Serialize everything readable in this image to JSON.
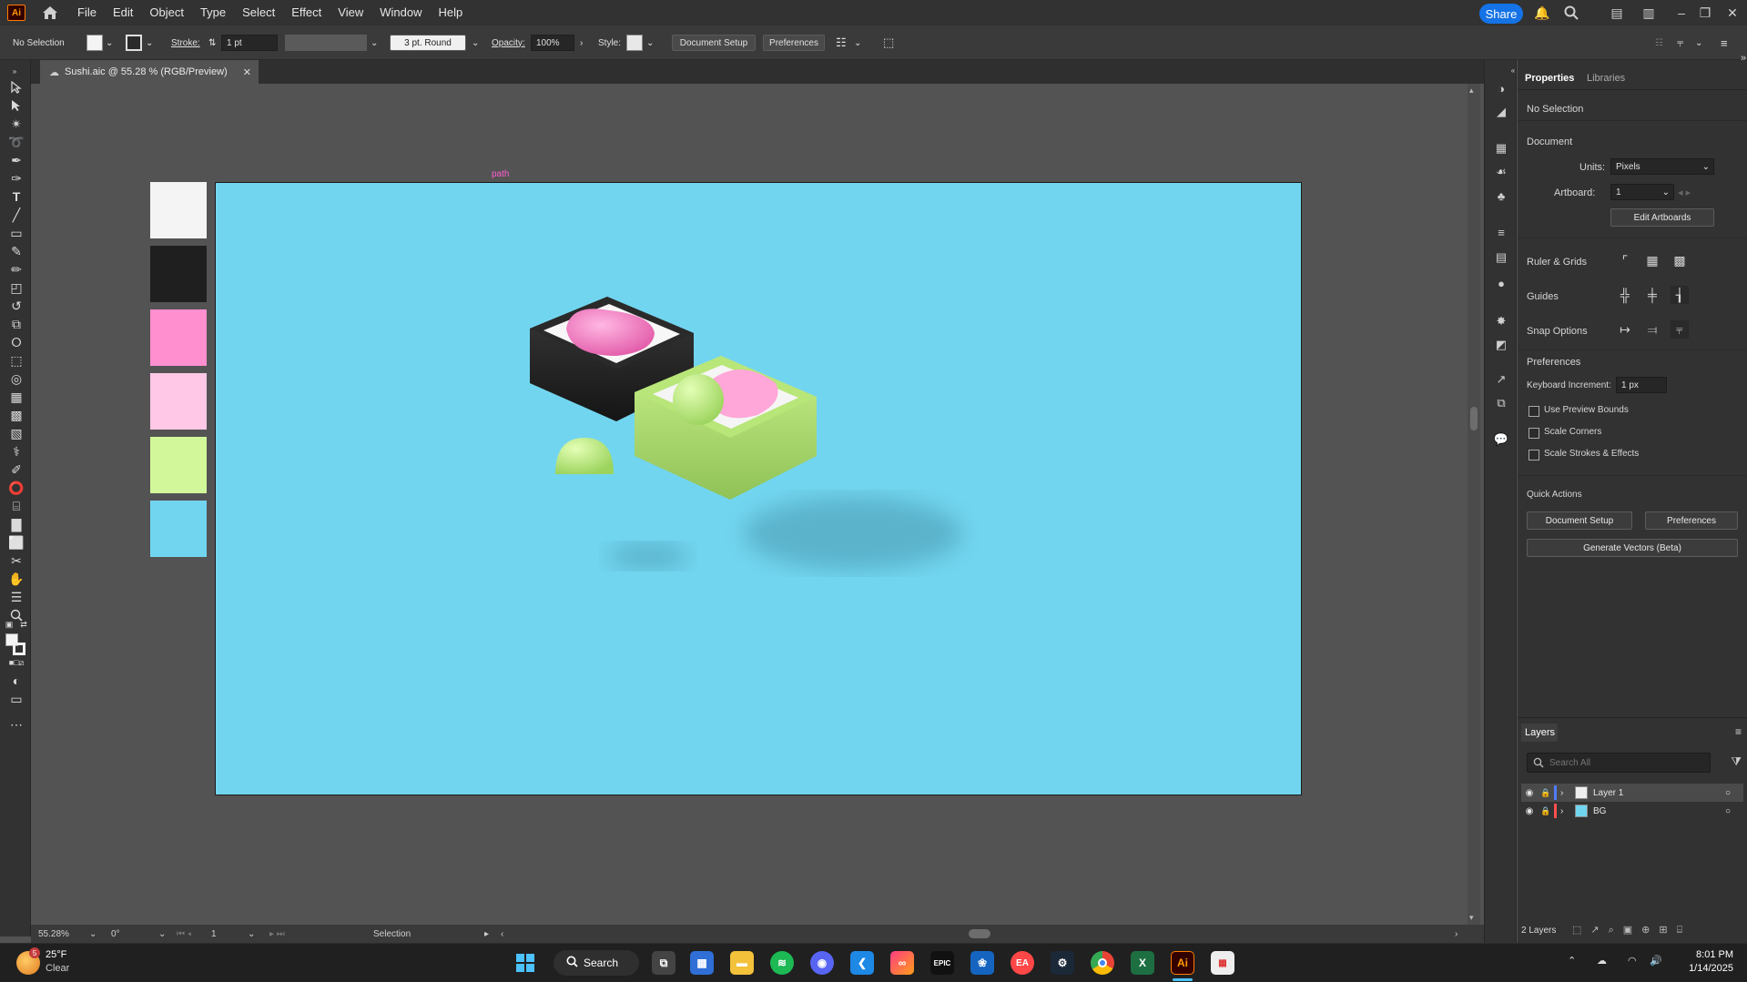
{
  "menubar": {
    "logo": "Ai",
    "items": [
      "File",
      "Edit",
      "Object",
      "Type",
      "Select",
      "Effect",
      "View",
      "Window",
      "Help"
    ],
    "share_label": "Share"
  },
  "control_bar": {
    "selection": "No Selection",
    "stroke_label": "Stroke:",
    "stroke_value": "1 pt",
    "brush_value": "3 pt. Round",
    "opacity_label": "Opacity:",
    "opacity_value": "100%",
    "style_label": "Style:",
    "document_setup": "Document Setup",
    "preferences": "Preferences"
  },
  "document_tab": {
    "title": "Sushi.aic @ 55.28 % (RGB/Preview)"
  },
  "canvas": {
    "path_label": "path",
    "swatches": [
      "#f4f4f4",
      "#1f1f1f",
      "#ff8fcf",
      "#ffc8e6",
      "#d2f79a",
      "#72d5ef"
    ],
    "artboard_color": "#72d5ef"
  },
  "status_bar": {
    "zoom": "55.28%",
    "rotation": "0°",
    "artboard": "1",
    "tool": "Selection"
  },
  "properties": {
    "tabs": [
      "Properties",
      "Libraries"
    ],
    "selection": "No Selection",
    "document_heading": "Document",
    "units_label": "Units:",
    "units_value": "Pixels",
    "artboard_label": "Artboard:",
    "artboard_value": "1",
    "edit_artboards": "Edit Artboards",
    "ruler_grids": "Ruler & Grids",
    "guides": "Guides",
    "snap_options": "Snap Options",
    "preferences_heading": "Preferences",
    "keyboard_increment_label": "Keyboard Increment:",
    "keyboard_increment_value": "1 px",
    "checkboxes": [
      "Use Preview Bounds",
      "Scale Corners",
      "Scale Strokes & Effects"
    ],
    "quick_actions": "Quick Actions",
    "qa_document_setup": "Document Setup",
    "qa_preferences": "Preferences",
    "generate_vectors": "Generate Vectors (Beta)"
  },
  "layers": {
    "title": "Layers",
    "search_placeholder": "Search All",
    "rows": [
      {
        "name": "Layer 1",
        "color": "#4f7cff"
      },
      {
        "name": "BG",
        "color": "#ff4f4f"
      }
    ],
    "count": "2 Layers"
  },
  "taskbar": {
    "weather_temp": "25°F",
    "weather_desc": "Clear",
    "weather_badge": "5",
    "search_label": "Search",
    "time": "8:01 PM",
    "date": "1/14/2025"
  }
}
